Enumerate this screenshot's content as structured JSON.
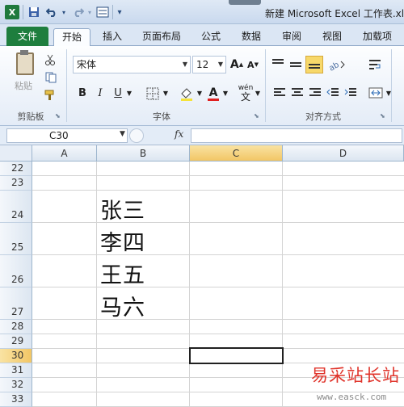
{
  "window": {
    "title": "新建 Microsoft Excel 工作表.xls",
    "app_logo": "X",
    "qat": {
      "save_icon": "save-icon",
      "undo_icon": "undo-icon",
      "redo_icon": "redo-icon",
      "custom_icon": "form-icon"
    }
  },
  "tabs": [
    {
      "label": "文件",
      "kind": "file"
    },
    {
      "label": "开始",
      "kind": "active"
    },
    {
      "label": "插入"
    },
    {
      "label": "页面布局"
    },
    {
      "label": "公式"
    },
    {
      "label": "数据"
    },
    {
      "label": "审阅"
    },
    {
      "label": "视图"
    },
    {
      "label": "加载项"
    }
  ],
  "ribbon": {
    "clipboard": {
      "paste_label": "粘贴",
      "group_label": "剪贴板"
    },
    "font": {
      "font_name": "宋体",
      "font_size": "12",
      "grow_label": "A",
      "shrink_label": "A",
      "bold": "B",
      "italic": "I",
      "underline": "U",
      "font_color_label": "A",
      "phonetic_label": "wén",
      "group_label": "字体"
    },
    "alignment": {
      "group_label": "对齐方式"
    }
  },
  "formula_bar": {
    "name_box": "C30",
    "fx_label": "fx",
    "formula": ""
  },
  "sheet": {
    "columns": [
      "A",
      "B",
      "C",
      "D"
    ],
    "rows": [
      "22",
      "23",
      "24",
      "25",
      "26",
      "27",
      "28",
      "29",
      "30",
      "31",
      "32",
      "33"
    ],
    "cells": {
      "B24": "张三",
      "B25": "李四",
      "B26": "王五",
      "B27": "马六"
    }
  },
  "watermark": {
    "title": "易采站长站",
    "url": "www.easck.com"
  },
  "colors": {
    "file_tab": "#1e7e3e",
    "watermark_red": "#e0342b",
    "highlight": "#f7d86a"
  }
}
